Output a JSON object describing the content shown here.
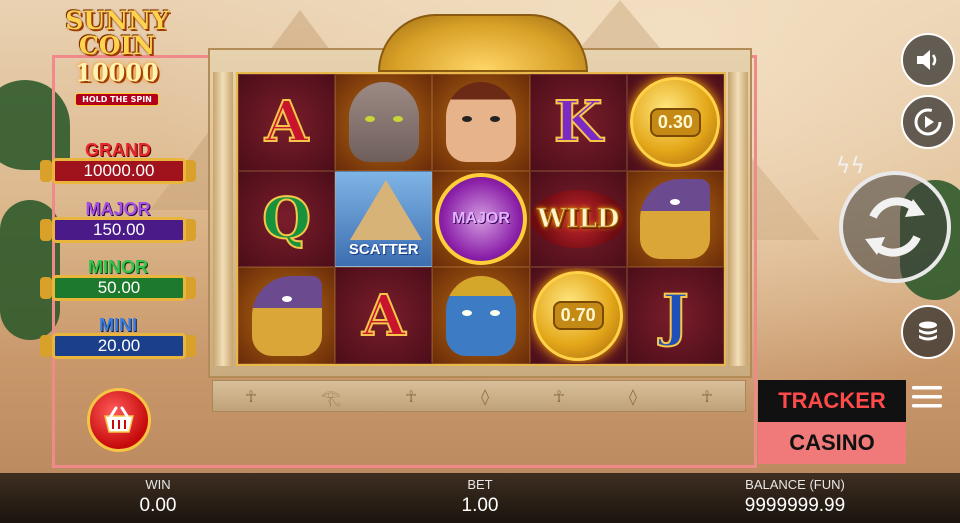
{
  "game": {
    "logo": {
      "line1": "SUNNY",
      "line2": "COIN",
      "line3": "10000",
      "tagline": "HOLD THE SPIN"
    },
    "jackpots": [
      {
        "label": "GRAND",
        "value": "10000.00",
        "label_color": "#e8272b",
        "box_color": "#a0121c"
      },
      {
        "label": "MAJOR",
        "value": "150.00",
        "label_color": "#a650e0",
        "box_color": "#4a1a88"
      },
      {
        "label": "MINOR",
        "value": "50.00",
        "label_color": "#35c44a",
        "box_color": "#1d7a2c"
      },
      {
        "label": "MINI",
        "value": "20.00",
        "label_color": "#3c7fe0",
        "box_color": "#1c3f8c"
      }
    ],
    "reels": [
      [
        "A",
        "cat",
        "queen",
        "K",
        "coin:0.30"
      ],
      [
        "Q",
        "SCATTER",
        "MAJOR",
        "WILD",
        "horus"
      ],
      [
        "horus",
        "A",
        "pharaoh",
        "coin:0.70",
        "J"
      ]
    ],
    "buy_feature_icon": "basket-icon"
  },
  "controls": {
    "sound_icon": "speaker-icon",
    "autoplay_icon": "autoplay-icon",
    "spin_icon": "spin-icon",
    "turbo_icon": "lightning-icon",
    "bet_icon": "coin-stack-icon",
    "menu_icon": "hamburger-icon"
  },
  "overlay": {
    "line1": "TRACKER",
    "line2": "CASINO"
  },
  "status_bar": {
    "win_label": "WIN",
    "win_value": "0.00",
    "bet_label": "BET",
    "bet_value": "1.00",
    "balance_label": "BALANCE (FUN)",
    "balance_value": "9999999.99"
  }
}
